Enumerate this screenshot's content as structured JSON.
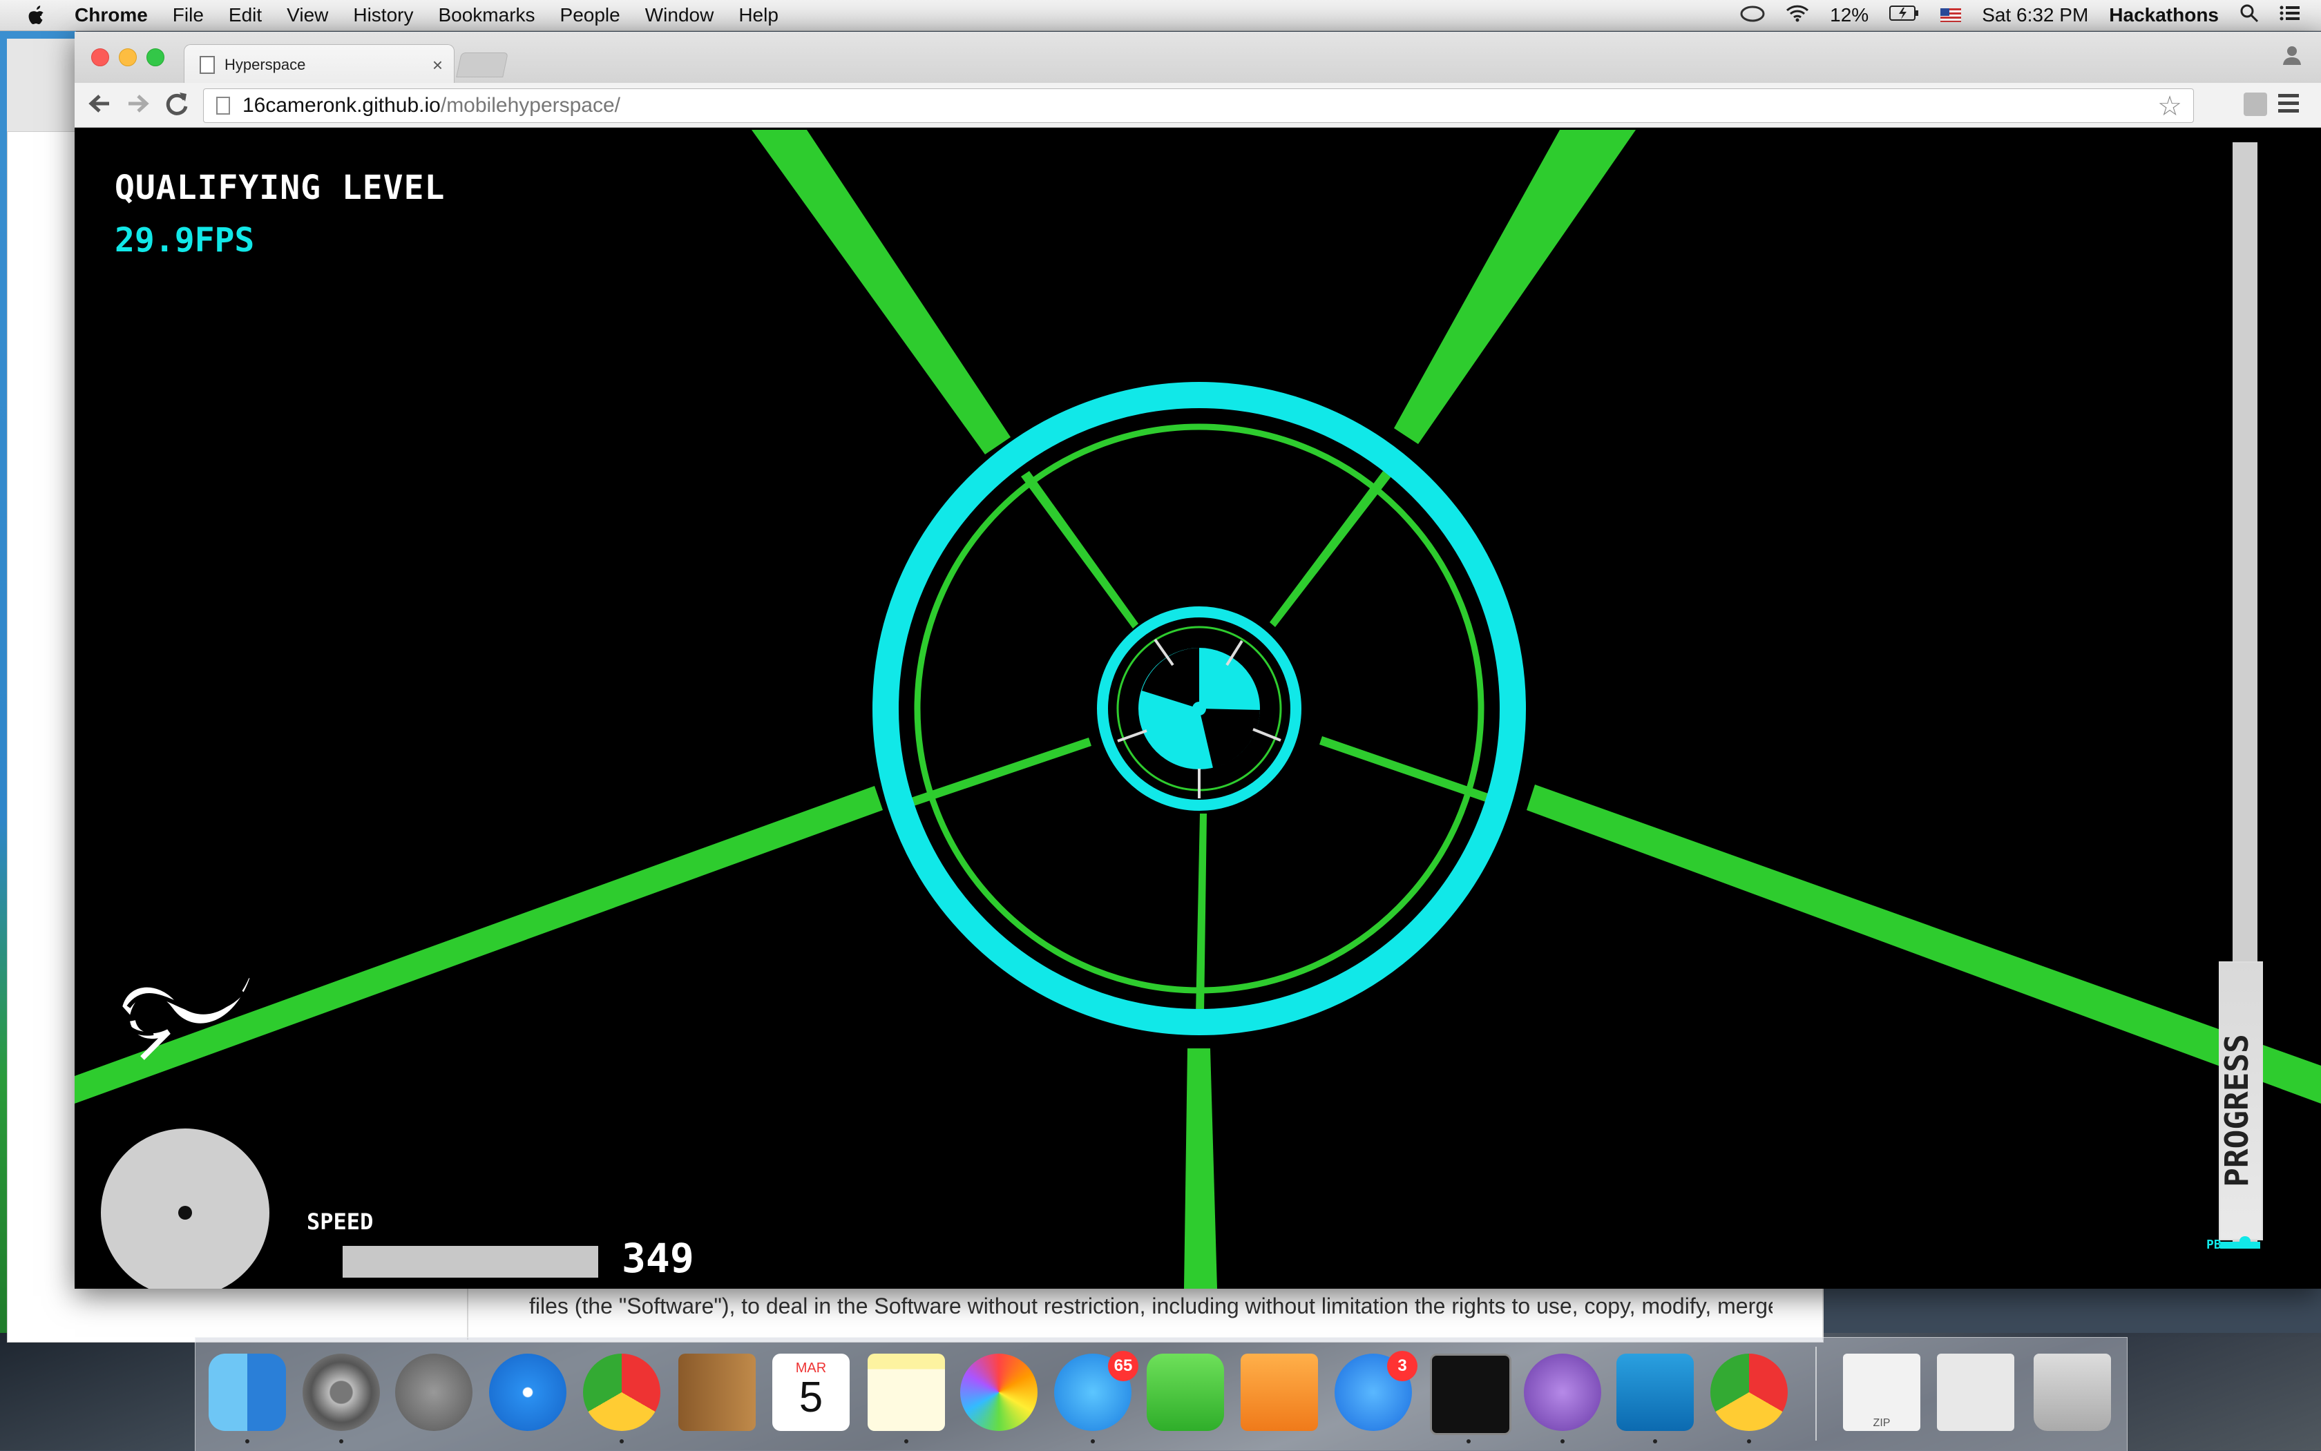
{
  "menubar": {
    "app": "Chrome",
    "items": [
      "File",
      "Edit",
      "View",
      "History",
      "Bookmarks",
      "People",
      "Window",
      "Help"
    ],
    "battery": "12%",
    "clock": "Sat 6:32 PM",
    "user": "Hackathons"
  },
  "browser": {
    "tab_title": "Hyperspace",
    "tab_close": "×",
    "url_host": "16cameronk.github.io",
    "url_path": "/mobilehyperspace/"
  },
  "game": {
    "level_title": "QUALIFYING LEVEL",
    "fps": "29.9FPS",
    "speed_label": "SPEED",
    "speed_value": "349",
    "progress_label": "PROGRESS",
    "pb_label": "PB",
    "progress_fraction": 0.0,
    "colors": {
      "ring": "#11e8e8",
      "spokes": "#2ecc2e",
      "background": "#000000"
    }
  },
  "background_doc": {
    "text": "files (the \"Software\"), to deal in the Software without restriction, including without limitation the rights to use, copy, modify, merge, publish, distribute, sublicense, and/or sell copies of the Software, and to permit persons to whom the Software is"
  },
  "dock": {
    "messages_badge": "65",
    "appstore_badge": "3",
    "calendar_month": "MAR",
    "calendar_day": "5",
    "zip_label": "ZIP"
  }
}
